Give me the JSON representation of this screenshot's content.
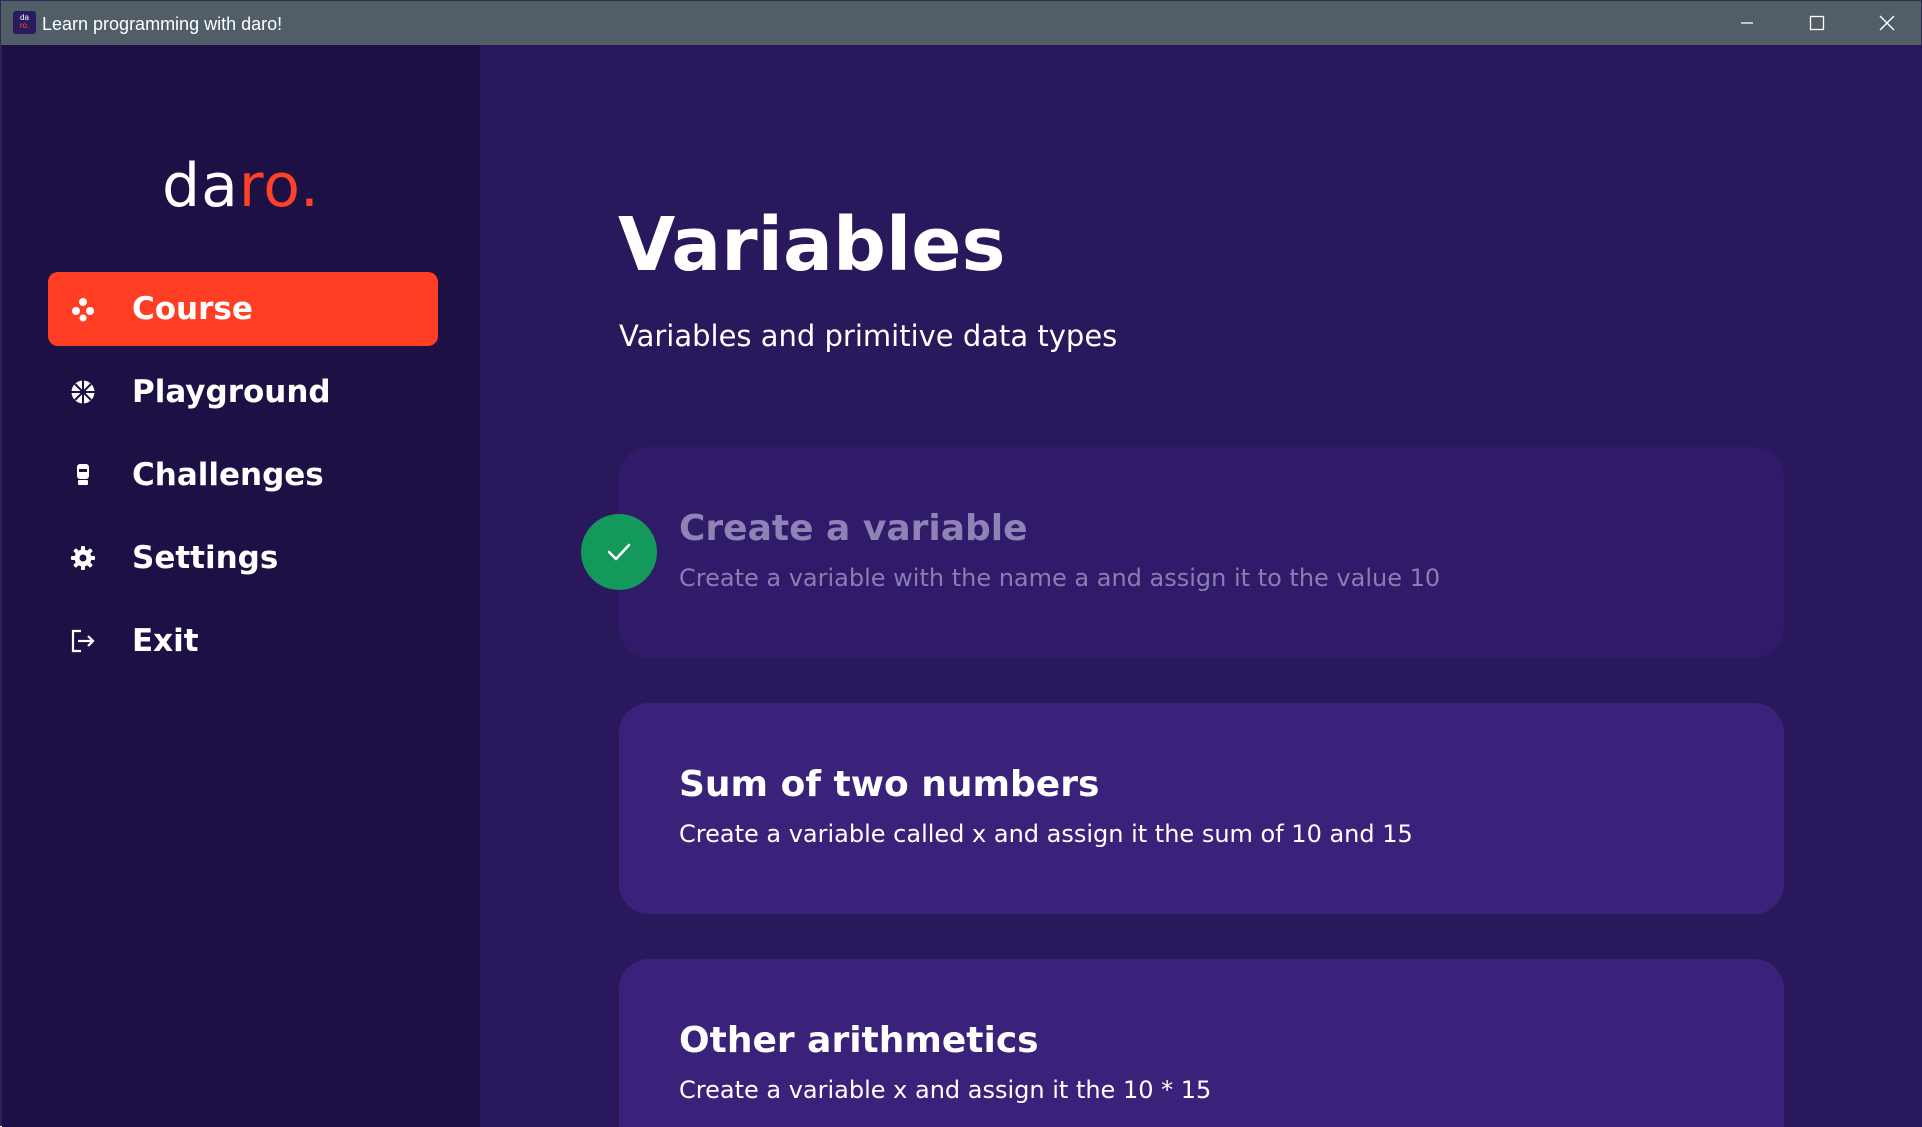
{
  "window": {
    "title": "Learn programming with daro!",
    "icon_line1": "da",
    "icon_line2": "ro.",
    "controls": [
      "minimize-icon",
      "maximize-icon",
      "close-icon"
    ]
  },
  "sidebar": {
    "logo_white": "da",
    "logo_accent": "ro.",
    "accent_color": "#ff3e24",
    "items": [
      {
        "label": "Course",
        "icon": "gamepad-icon",
        "active": true
      },
      {
        "label": "Playground",
        "icon": "basketball-icon",
        "active": false
      },
      {
        "label": "Challenges",
        "icon": "trophy-icon",
        "active": false
      },
      {
        "label": "Settings",
        "icon": "gear-icon",
        "active": false
      },
      {
        "label": "Exit",
        "icon": "logout-icon",
        "active": false
      }
    ]
  },
  "main": {
    "title": "Variables",
    "subtitle": "Variables and primitive data types",
    "lessons": [
      {
        "title": "Create a variable",
        "description": "Create a variable with the name a and assign it to the value 10",
        "completed": true
      },
      {
        "title": "Sum of two numbers",
        "description": "Create a variable called x and assign it the sum of 10 and 15",
        "completed": false
      },
      {
        "title": "Other arithmetics",
        "description": "Create a variable x and assign it the 10 * 15",
        "completed": false
      }
    ],
    "completed_color": "#12995b"
  }
}
